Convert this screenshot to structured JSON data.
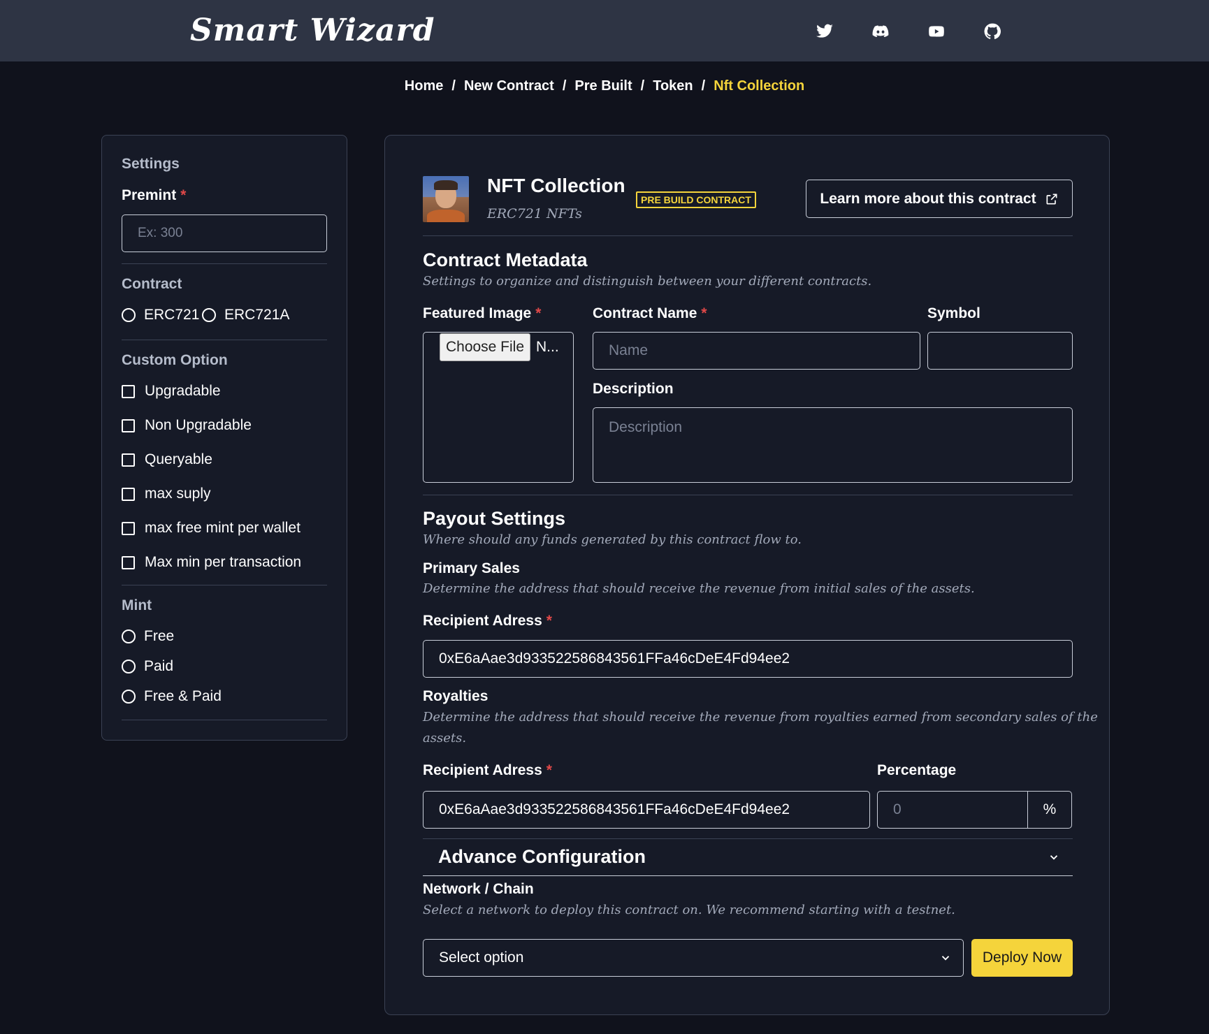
{
  "brand": "Smart Wizard",
  "social_icons": [
    "twitter-icon",
    "discord-icon",
    "youtube-icon",
    "github-icon"
  ],
  "breadcrumb": {
    "items": [
      "Home",
      "New Contract",
      "Pre Built",
      "Token"
    ],
    "current": "Nft Collection",
    "separator": "/"
  },
  "sidebar": {
    "settings_title": "Settings",
    "premint_label": "Premint",
    "premint_placeholder": "Ex: 300",
    "contract_title": "Contract",
    "contract_options": [
      "ERC721",
      "ERC721A"
    ],
    "custom_title": "Custom Option",
    "custom_options": [
      "Upgradable",
      "Non Upgradable",
      "Queryable",
      "max suply",
      "max free mint per wallet",
      "Max min per transaction"
    ],
    "mint_title": "Mint",
    "mint_options": [
      "Free",
      "Paid",
      "Free & Paid"
    ]
  },
  "main": {
    "title": "NFT Collection",
    "subtitle": "ERC721 NFTs",
    "badge": "PRE BUILD CONTRACT",
    "learn_more": "Learn more about this contract",
    "metadata": {
      "heading": "Contract Metadata",
      "description": "Settings to organize and distinguish between your different contracts.",
      "featured_image_label": "Featured Image",
      "choose_file": "Choose File",
      "file_name": "N...",
      "contract_name_label": "Contract Name",
      "contract_name_placeholder": "Name",
      "symbol_label": "Symbol",
      "description_label": "Description",
      "description_placeholder": "Description"
    },
    "payout": {
      "heading": "Payout Settings",
      "description": "Where should any funds generated by this contract flow to.",
      "primary_title": "Primary Sales",
      "primary_desc": "Determine the address that should receive the revenue from initial sales of the assets.",
      "recipient_label": "Recipient Adress",
      "primary_address": "0xE6aAae3d933522586843561FFa46cDeE4Fd94ee2",
      "royalties_title": "Royalties",
      "royalties_desc_line1": "Determine the address that should receive the revenue from royalties earned from secondary sales of the",
      "royalties_desc_line2": "assets.",
      "royalty_recipient_label": "Recipient Adress",
      "royalty_address": "0xE6aAae3d933522586843561FFa46cDeE4Fd94ee2",
      "percentage_label": "Percentage",
      "percentage_placeholder": "0",
      "percentage_suffix": "%"
    },
    "advance": {
      "title": "Advance Configuration"
    },
    "network": {
      "title": "Network / Chain",
      "description": "Select a network to deploy this contract on. We recommend starting with a testnet.",
      "select_value": "Select option",
      "deploy_label": "Deploy Now"
    }
  },
  "colors": {
    "background": "#10121c",
    "header": "#2e3444",
    "card": "#161a27",
    "accent": "#f5d43b",
    "required": "#e04848"
  }
}
